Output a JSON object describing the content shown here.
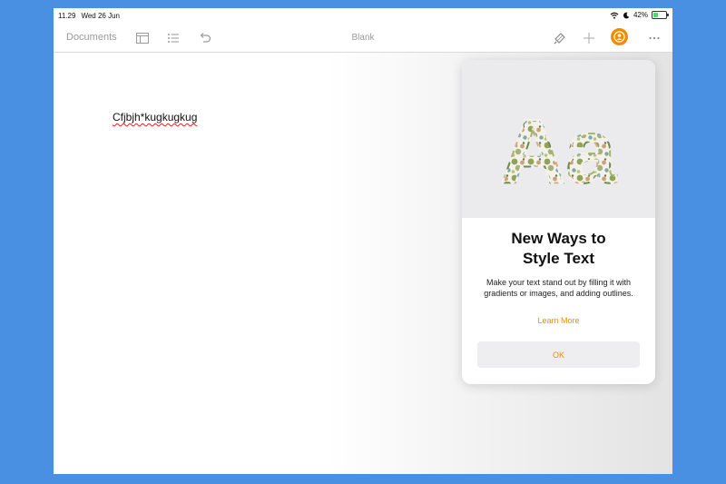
{
  "status_bar": {
    "time": "11.29",
    "date": "Wed 26 Jun",
    "battery": "42%",
    "battery_level": 0.42
  },
  "toolbar": {
    "documents_label": "Documents",
    "title": "Blank",
    "icons": [
      "sidebar-icon",
      "list-icon",
      "undo-icon",
      "format-brush-icon",
      "add-icon",
      "collaborate-icon",
      "more-icon"
    ]
  },
  "document": {
    "text": "Cfjbjh*kugkugkug"
  },
  "popover": {
    "title_line1": "New Ways to",
    "title_line2": "Style Text",
    "description": "Make your text stand out by filling it with gradients or images, and adding outlines.",
    "learn_more": "Learn More",
    "ok_label": "OK",
    "hero_text": "Aa"
  },
  "colors": {
    "accent": "#f08c00",
    "frame": "#4a90e2",
    "spell_error": "#e02020"
  }
}
